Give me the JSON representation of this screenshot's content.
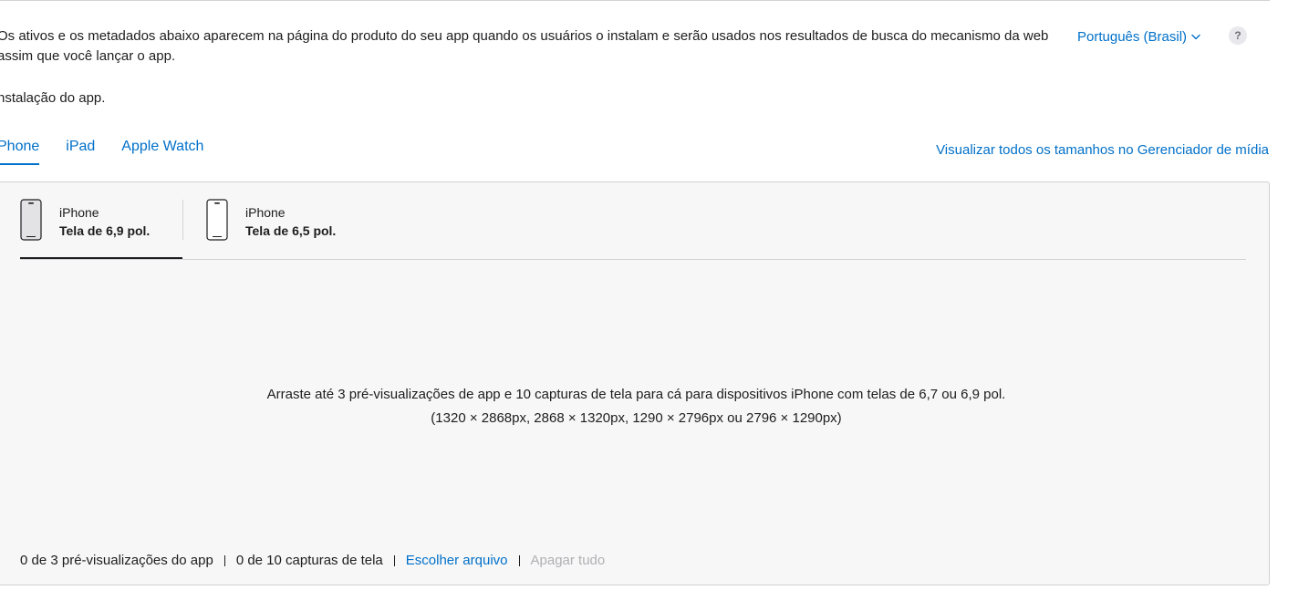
{
  "description": {
    "line1": "Os ativos e os metadados abaixo aparecem na página do produto do seu app quando os usuários o instalam e serão usados nos resultados de busca do mecanismo da web assim que você lançar o app.",
    "line2": "nstalação do app."
  },
  "language": {
    "label": "Português (Brasil)",
    "help": "?"
  },
  "tabs": [
    {
      "label": "Phone",
      "active": true
    },
    {
      "label": "iPad",
      "active": false
    },
    {
      "label": "Apple Watch",
      "active": false
    }
  ],
  "media_link": "Visualizar todos os tamanhos no Gerenciador de mídia",
  "devices": [
    {
      "line1": "iPhone",
      "line2": "Tela de 6,9 pol.",
      "active": true
    },
    {
      "line1": "iPhone",
      "line2": "Tela de 6,5 pol.",
      "active": false
    }
  ],
  "dropzone": {
    "line1": "Arraste até 3 pré-visualizações de app e 10 capturas de tela para cá para dispositivos iPhone com telas de 6,7 ou 6,9 pol.",
    "line2": "(1320 × 2868px, 2868 × 1320px, 1290 × 2796px ou 2796 × 1290px)"
  },
  "footer": {
    "previews_count": "0 de 3 pré-visualizações do app",
    "screenshots_count": "0 de 10 capturas de tela",
    "choose_file": "Escolher arquivo",
    "delete_all": "Apagar tudo"
  },
  "colors": {
    "link": "#0070c9",
    "text": "#1d1d1f",
    "disabled": "#b0b0b5",
    "panel_bg": "#f7f7f7",
    "border": "#d2d2d7"
  }
}
